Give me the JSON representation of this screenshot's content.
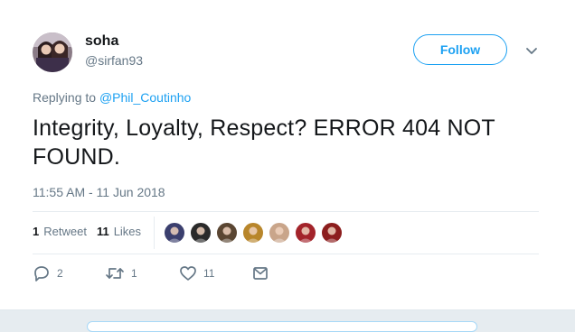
{
  "user": {
    "name": "soha",
    "handle": "@sirfan93"
  },
  "follow_label": "Follow",
  "reply": {
    "prefix": "Replying to",
    "to": "@Phil_Coutinho"
  },
  "tweet": {
    "text": "Integrity, Loyalty, Respect? ERROR 404 NOT FOUND.",
    "timestamp": "11:55 AM - 11 Jun 2018"
  },
  "stats": {
    "retweets": {
      "count": "1",
      "label": "Retweet"
    },
    "likes": {
      "count": "11",
      "label": "Likes"
    }
  },
  "likers": [
    {
      "icon": "liker-avatar-1",
      "color": "#3b3f6e"
    },
    {
      "icon": "liker-avatar-2",
      "color": "#2a2a2a"
    },
    {
      "icon": "liker-avatar-3",
      "color": "#5a4632"
    },
    {
      "icon": "liker-avatar-4",
      "color": "#b8862b"
    },
    {
      "icon": "liker-avatar-5",
      "color": "#c9a58a"
    },
    {
      "icon": "liker-avatar-6",
      "color": "#a3232a"
    },
    {
      "icon": "liker-avatar-7",
      "color": "#8c1d1d"
    }
  ],
  "actions": {
    "reply": {
      "icon": "reply-icon",
      "count": "2"
    },
    "retweet": {
      "icon": "retweet-icon",
      "count": "1"
    },
    "like": {
      "icon": "heart-icon",
      "count": "11"
    },
    "dm": {
      "icon": "envelope-icon"
    }
  },
  "colors": {
    "accent": "#1da1f2",
    "muted": "#657786",
    "text": "#14171a"
  }
}
